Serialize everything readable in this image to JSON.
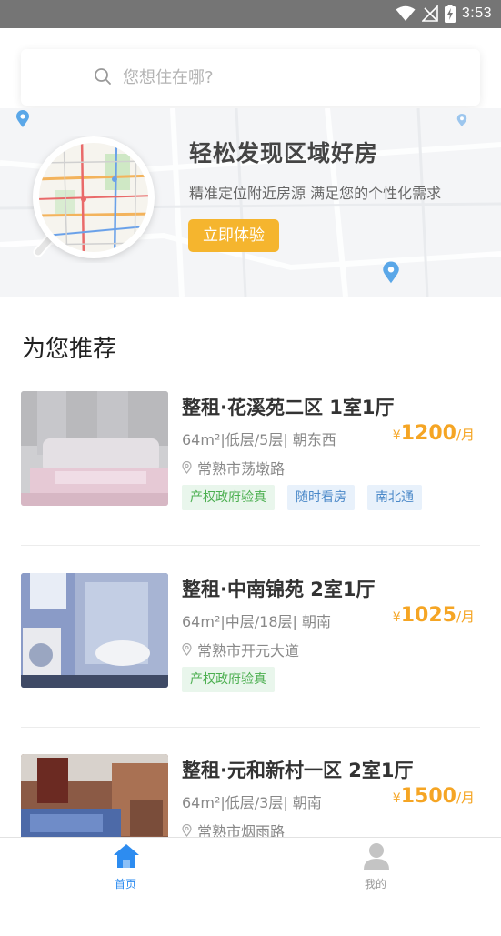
{
  "status_bar": {
    "time": "3:53"
  },
  "search": {
    "placeholder": "您想住在哪?"
  },
  "banner": {
    "title": "轻松发现区域好房",
    "subtitle": "精准定位附近房源 满足您的个性化需求",
    "button_label": "立即体验"
  },
  "section": {
    "title": "为您推荐"
  },
  "listings": [
    {
      "title": "整租·花溪苑二区 1室1厅",
      "specs": "64m²|低层/5层| 朝东西",
      "price_currency": "¥",
      "price_amount": "1200",
      "price_unit": "/月",
      "address": "常熟市荡墩路",
      "tags": [
        {
          "label": "产权政府验真",
          "style": "green"
        },
        {
          "label": "随时看房",
          "style": "blue"
        },
        {
          "label": "南北通",
          "style": "blue"
        }
      ]
    },
    {
      "title": "整租·中南锦苑 2室1厅",
      "specs": "64m²|中层/18层| 朝南",
      "price_currency": "¥",
      "price_amount": "1025",
      "price_unit": "/月",
      "address": "常熟市开元大道",
      "tags": [
        {
          "label": "产权政府验真",
          "style": "green"
        }
      ]
    },
    {
      "title": "整租·元和新村一区 2室1厅",
      "specs": "64m²|低层/3层| 朝南",
      "price_currency": "¥",
      "price_amount": "1500",
      "price_unit": "/月",
      "address": "常熟市烟雨路",
      "tags": []
    }
  ],
  "tab_bar": {
    "items": [
      {
        "label": "首页",
        "icon": "home-icon",
        "active": true
      },
      {
        "label": "我的",
        "icon": "user-icon",
        "active": false
      }
    ]
  },
  "colors": {
    "accent": "#f5a524",
    "button": "#f5b52e",
    "tab_active": "#2d8cf0",
    "tab_inactive": "#999999",
    "tag_green": "#4caf50",
    "tag_blue": "#4a88c8"
  }
}
